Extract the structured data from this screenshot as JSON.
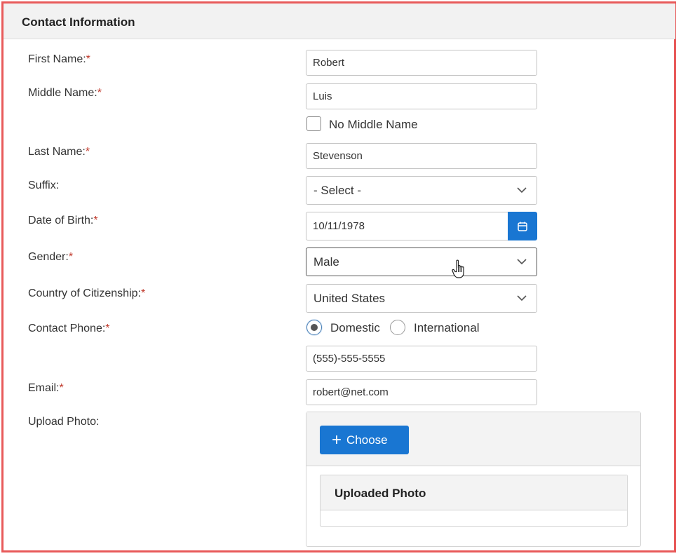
{
  "header": {
    "title": "Contact Information"
  },
  "fields": {
    "first_name": {
      "label": "First Name:",
      "required": "*",
      "value": "Robert"
    },
    "middle_name": {
      "label": "Middle Name:",
      "required": "*",
      "value": "Luis"
    },
    "no_middle_name": {
      "label": "No Middle Name",
      "checked": false
    },
    "last_name": {
      "label": "Last Name:",
      "required": "*",
      "value": "Stevenson"
    },
    "suffix": {
      "label": "Suffix:",
      "value": "- Select -"
    },
    "dob": {
      "label": "Date of Birth:",
      "required": "*",
      "value": "10/11/1978"
    },
    "gender": {
      "label": "Gender:",
      "required": "*",
      "value": "Male"
    },
    "citizenship": {
      "label": "Country of Citizenship:",
      "required": "*",
      "value": "United States"
    },
    "phone": {
      "label": "Contact Phone:",
      "required": "*",
      "option_domestic": "Domestic",
      "option_international": "International",
      "selected": "Domestic",
      "value": "(555)-555-5555"
    },
    "email": {
      "label": "Email:",
      "required": "*",
      "value": "robert@net.com"
    },
    "photo": {
      "label": "Upload Photo:",
      "choose_label": "Choose",
      "uploaded_title": "Uploaded Photo"
    }
  },
  "icons": {
    "calendar": "calendar-icon",
    "chevron": "chevron-down-icon",
    "plus": "plus-icon",
    "cursor": "hand-cursor-icon"
  },
  "colors": {
    "accent": "#1976d2",
    "required": "#c0392b",
    "frame": "#e85a5a"
  }
}
